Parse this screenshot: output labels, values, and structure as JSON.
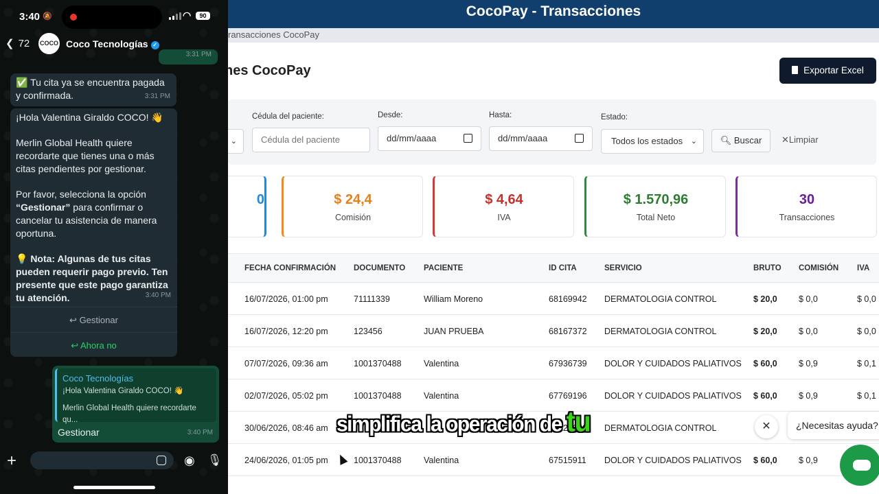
{
  "phone": {
    "status": {
      "time": "3:40",
      "battery": "90"
    },
    "header": {
      "back_count": "72",
      "contact_name": "Coco Tecnologías",
      "avatar_text": "COCO"
    },
    "messages": {
      "top_time": "3:31 PM",
      "paid_text": "✅ Tu cita ya se encuentra pagada y confirmada.",
      "paid_time": "3:31 PM",
      "reminder_greeting": "¡Hola Valentina Giraldo COCO! 👋",
      "reminder_p1": "Merlin Global Health quiere recordarte que tienes una o más citas pendientes por gestionar.",
      "reminder_p2a": "Por favor, selecciona la opción ",
      "reminder_p2b": "“Gestionar”",
      "reminder_p2c": " para confirmar o cancelar tu asistencia de manera oportuna.",
      "reminder_p3": "💡 Nota: Algunas de tus citas pueden requerir pago previo. Ten presente que este pago garantiza tu atención.",
      "reminder_time": "3:40 PM",
      "btn_manage": "Gestionar",
      "btn_not_now": "Ahora no",
      "reply_quote_name": "Coco Tecnologías",
      "reply_quote_line1": "¡Hola Valentina Giraldo COCO! 👋",
      "reply_quote_line2": "Merlin Global Health quiere recordarte qu...",
      "reply_text": "Gestionar",
      "reply_time": "3:40 PM"
    }
  },
  "app": {
    "title": "CocoPay - Transacciones",
    "tab": "ransacciones CocoPay",
    "page_title": "nes CocoPay",
    "export_label": "Exportar Excel",
    "filters": {
      "cedula_label": "Cédula del paciente:",
      "cedula_placeholder": "Cédula del paciente",
      "desde_label": "Desde:",
      "desde_value": "dd/mm/aaaa",
      "hasta_label": "Hasta:",
      "hasta_value": "dd/mm/aaaa",
      "estado_label": "Estado:",
      "estado_value": "Todos los estados",
      "search_label": "Buscar",
      "clear_label": "Limpiar"
    },
    "cards": [
      {
        "value": "0",
        "label": ""
      },
      {
        "value": "$ 24,4",
        "label": "Comisión"
      },
      {
        "value": "$ 4,64",
        "label": "IVA"
      },
      {
        "value": "$ 1.570,96",
        "label": "Total Neto"
      },
      {
        "value": "30",
        "label": "Transacciones"
      }
    ],
    "table": {
      "headers": [
        "FECHA CONFIRMACIÓN",
        "DOCUMENTO",
        "PACIENTE",
        "ID CITA",
        "SERVICIO",
        "BRUTO",
        "COMISIÓN",
        "IVA"
      ],
      "rows": [
        [
          "16/07/2026, 01:00 pm",
          "71111339",
          "William Moreno",
          "68169942",
          "DERMATOLOGIA CONTROL",
          "$ 20,0",
          "$ 0,0",
          "$ 0,0"
        ],
        [
          "16/07/2026, 12:20 pm",
          "123456",
          "JUAN PRUEBA",
          "68167372",
          "DERMATOLOGIA CONTROL",
          "$ 20,0",
          "$ 0,0",
          "$ 0,0"
        ],
        [
          "07/07/2026, 09:36 am",
          "1001370488",
          "Valentina",
          "67936739",
          "DOLOR Y CUIDADOS PALIATIVOS",
          "$ 60,0",
          "$ 0,9",
          "$ 0,1"
        ],
        [
          "02/07/2026, 05:02 pm",
          "1001370488",
          "Valentina",
          "67769196",
          "DOLOR Y CUIDADOS PALIATIVOS",
          "$ 60,0",
          "$ 0,9",
          "$ 0,1"
        ],
        [
          "30/06/2026, 08:46 am",
          "",
          "",
          "67625691",
          "DERMATOLOGIA CONTROL",
          "",
          "",
          ""
        ],
        [
          "24/06/2026, 01:05 pm",
          "1001370488",
          "Valentina",
          "67515911",
          "DOLOR Y CUIDADOS PALIATIVOS",
          "$ 60,0",
          "$ 0,9",
          ""
        ]
      ]
    },
    "subtitle_pre": "simplifica la operación de ",
    "subtitle_hl": "tu",
    "help_text": "¿Necesitas ayuda?"
  }
}
